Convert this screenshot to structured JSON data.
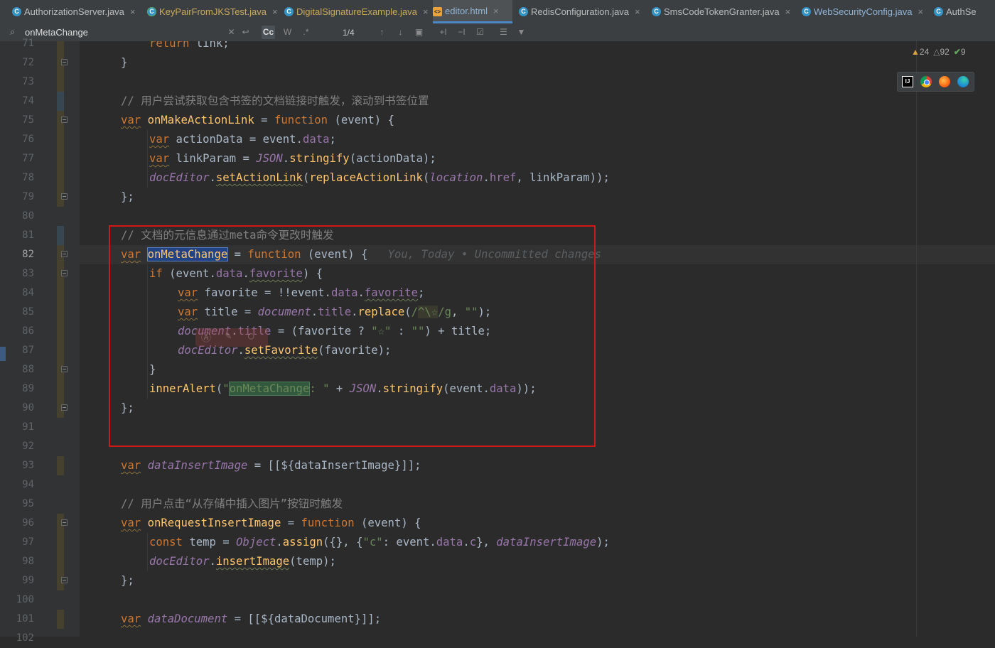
{
  "tabs": [
    {
      "label": "AuthorizationServer.java",
      "icon": "java-class-icon",
      "active": false
    },
    {
      "label": "KeyPairFromJKSTest.java",
      "icon": "java-test-class-icon",
      "active": false
    },
    {
      "label": "DigitalSignatureExample.java",
      "icon": "java-class-icon",
      "active": false
    },
    {
      "label": "editor.html",
      "icon": "html-file-icon",
      "active": true
    },
    {
      "label": "RedisConfiguration.java",
      "icon": "java-class-icon",
      "active": false
    },
    {
      "label": "SmsCodeTokenGranter.java",
      "icon": "java-class-icon",
      "active": false
    },
    {
      "label": "WebSecurityConfig.java",
      "icon": "java-class-icon",
      "active": false
    },
    {
      "label": "AuthSe",
      "icon": "java-class-icon",
      "active": false
    }
  ],
  "tab_close_glyph": "×",
  "search": {
    "value": "onMetaChange",
    "match_count": "1/4",
    "icons": [
      "search-icon",
      "clear-icon",
      "history-icon",
      "match-case-icon",
      "words-icon",
      "regex-icon",
      "prev-icon",
      "next-icon",
      "select-all-icon",
      "add-selection-icon",
      "remove-selection-icon",
      "select-all-occurrences-icon",
      "filter-settings-icon",
      "filter-icon"
    ],
    "cc_label": "Cc",
    "w_label": "W",
    "regex_label": ".*"
  },
  "inspections": {
    "warnings": "24",
    "weak_warnings": "92",
    "typos": "9"
  },
  "browser_icons": [
    "intellij-icon",
    "chrome-icon",
    "firefox-icon",
    "edge-icon"
  ],
  "blame": "You, Today • Uncommitted changes",
  "lines": {
    "l71": "71",
    "l72": "72",
    "l73": "73",
    "l74": "74",
    "l75": "75",
    "l76": "76",
    "l77": "77",
    "l78": "78",
    "l79": "79",
    "l80": "80",
    "l81": "81",
    "l82": "82",
    "l83": "83",
    "l84": "84",
    "l85": "85",
    "l86": "86",
    "l87": "87",
    "l88": "88",
    "l89": "89",
    "l90": "90",
    "l91": "91",
    "l92": "92",
    "l93": "93",
    "l94": "94",
    "l95": "95",
    "l96": "96",
    "l97": "97",
    "l98": "98",
    "l99": "99",
    "l100": "100",
    "l101": "101",
    "l102": "102"
  },
  "code": {
    "c71": "return link;",
    "c72": "}",
    "c74": "// 用户尝试获取包含书签的文档链接时触发，滚动到书签位置",
    "c81": "// 文档的元信息通过meta命令更改时触发",
    "c95": "// 用户点击“从存储中插入图片”按钮时触发",
    "var": "var",
    "function": "function",
    "if": "if",
    "const": "const",
    "onMakeActionLink": "onMakeActionLink",
    "onMetaChange": "onMetaChange",
    "dataInsertImage": "dataInsertImage",
    "onRequestInsertImage": "onRequestInsertImage",
    "dataDocument": "dataDocument"
  }
}
